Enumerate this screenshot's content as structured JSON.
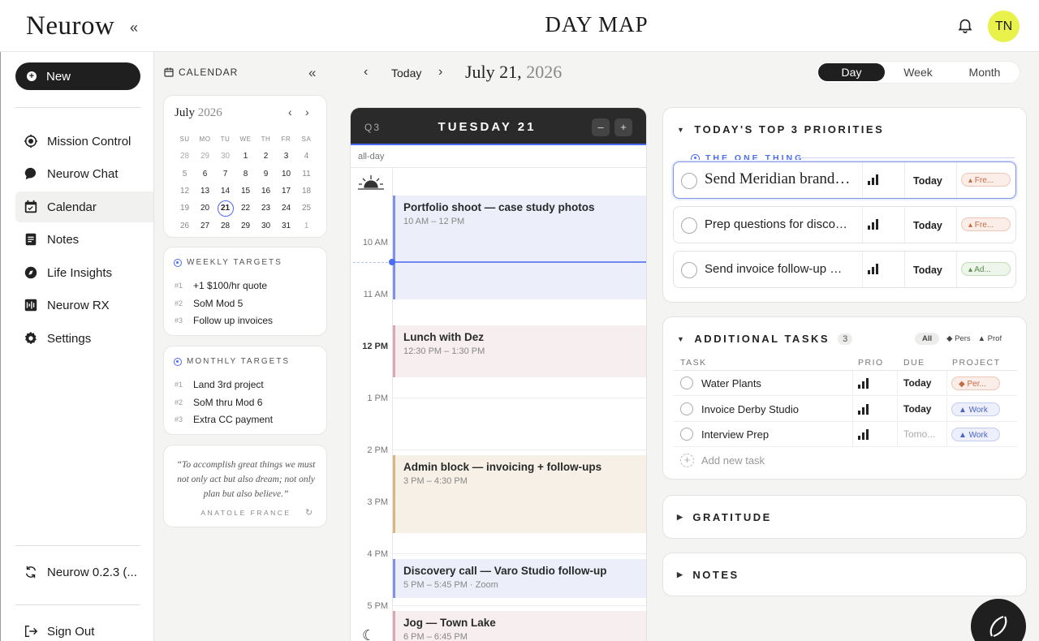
{
  "app": {
    "logo": "Neurow",
    "page_title": "DAY MAP",
    "avatar_initials": "TN"
  },
  "sidebar": {
    "new_label": "New",
    "items": [
      {
        "label": "Mission Control",
        "icon": "target-icon"
      },
      {
        "label": "Neurow Chat",
        "icon": "chat-bubble-icon"
      },
      {
        "label": "Calendar",
        "icon": "calendar-icon",
        "active": true
      },
      {
        "label": "Notes",
        "icon": "notes-icon"
      },
      {
        "label": "Life Insights",
        "icon": "compass-icon"
      },
      {
        "label": "Neurow RX",
        "icon": "waveform-icon"
      },
      {
        "label": "Settings",
        "icon": "gear-icon"
      }
    ],
    "version_label": "Neurow 0.2.3 (...",
    "signout_label": "Sign Out"
  },
  "calendar_panel": {
    "heading": "CALENDAR",
    "mini": {
      "month": "July",
      "year": "2026",
      "weekdays": [
        "SU",
        "MO",
        "TU",
        "WE",
        "TH",
        "FR",
        "SA"
      ],
      "weeks": [
        [
          "28",
          "29",
          "30",
          "1",
          "2",
          "3",
          "4"
        ],
        [
          "5",
          "6",
          "7",
          "8",
          "9",
          "10",
          "11"
        ],
        [
          "12",
          "13",
          "14",
          "15",
          "16",
          "17",
          "18"
        ],
        [
          "19",
          "20",
          "21",
          "22",
          "23",
          "24",
          "25"
        ],
        [
          "26",
          "27",
          "28",
          "29",
          "30",
          "31",
          "1"
        ]
      ],
      "today": "21"
    },
    "weekly": {
      "heading": "WEEKLY TARGETS",
      "items": [
        {
          "num": "#1",
          "text": "+1 $100/hr quote"
        },
        {
          "num": "#2",
          "text": "SoM Mod 5"
        },
        {
          "num": "#3",
          "text": "Follow up invoices"
        }
      ]
    },
    "monthly": {
      "heading": "MONTHLY TARGETS",
      "items": [
        {
          "num": "#1",
          "text": "Land 3rd project"
        },
        {
          "num": "#2",
          "text": "SoM thru Mod 6"
        },
        {
          "num": "#3",
          "text": "Extra CC payment"
        }
      ]
    },
    "quote": {
      "text": "“To accomplish great things we must not only act but also dream; not only plan but also believe.”",
      "author": "ANATOLE FRANCE"
    }
  },
  "day_view": {
    "today_label": "Today",
    "date_main": "July 21,",
    "date_year": "2026",
    "views": [
      "Day",
      "Week",
      "Month"
    ],
    "active_view": "Day",
    "quarter": "Q3",
    "day_label": "TUESDAY 21",
    "allday_label": "all-day",
    "hours": [
      "10 AM",
      "11 AM",
      "12 PM",
      "1 PM",
      "2 PM",
      "3 PM",
      "4 PM",
      "5 PM"
    ],
    "bold_hour": "12 PM",
    "events": [
      {
        "title": "Portfolio shoot — case study photos",
        "time": "10 AM – 12 PM",
        "style": "blue"
      },
      {
        "title": "Lunch with Dez",
        "time": "12:30 PM – 1:30 PM",
        "style": "pink"
      },
      {
        "title": "Admin block — invoicing + follow-ups",
        "time": "3 PM – 4:30 PM",
        "style": "tan"
      },
      {
        "title": "Discovery call — Varo Studio follow-up",
        "time": "5 PM – 5:45 PM · Zoom",
        "style": "blue"
      },
      {
        "title": "Jog — Town Lake",
        "time": "6 PM – 6:45 PM",
        "style": "pink"
      }
    ]
  },
  "priorities": {
    "heading": "TODAY'S TOP 3 PRIORITIES",
    "one_thing_label": "THE ONE THING",
    "items": [
      {
        "title": "Send Meridian brand guide",
        "due": "Today",
        "tag": "Freelance",
        "tag_short": "▴ Fre...",
        "tag_style": "fre"
      },
      {
        "title": "Prep questions for discovery call",
        "due": "Today",
        "tag": "Freelance",
        "tag_short": "▴ Fre...",
        "tag_style": "fre"
      },
      {
        "title": "Send invoice follow-up — Derby",
        "due": "Today",
        "tag": "Admin",
        "tag_short": "▴ Ad...",
        "tag_style": "adm"
      }
    ]
  },
  "additional": {
    "heading": "ADDITIONAL TASKS",
    "count": "3",
    "filters": [
      "All",
      "◆ Pers",
      "▲ Prof"
    ],
    "columns": [
      "TASK",
      "PRIO",
      "DUE",
      "PROJECT"
    ],
    "tasks": [
      {
        "title": "Water Plants",
        "due": "Today",
        "tag_short": "◆ Per...",
        "tag_style": "per",
        "due_muted": false
      },
      {
        "title": "Invoice Derby Studio",
        "due": "Today",
        "tag_short": "▲ Work",
        "tag_style": "work",
        "due_muted": false
      },
      {
        "title": "Interview Prep",
        "due": "Tomo...",
        "tag_short": "▲ Work",
        "tag_style": "work",
        "due_muted": true
      }
    ],
    "add_label": "Add new task"
  },
  "gratitude": {
    "heading": "GRATITUDE"
  },
  "notes": {
    "heading": "NOTES"
  },
  "colors": {
    "accent": "#4a6cf7",
    "avatar": "#e9f24a",
    "dark": "#1f1f1f"
  }
}
